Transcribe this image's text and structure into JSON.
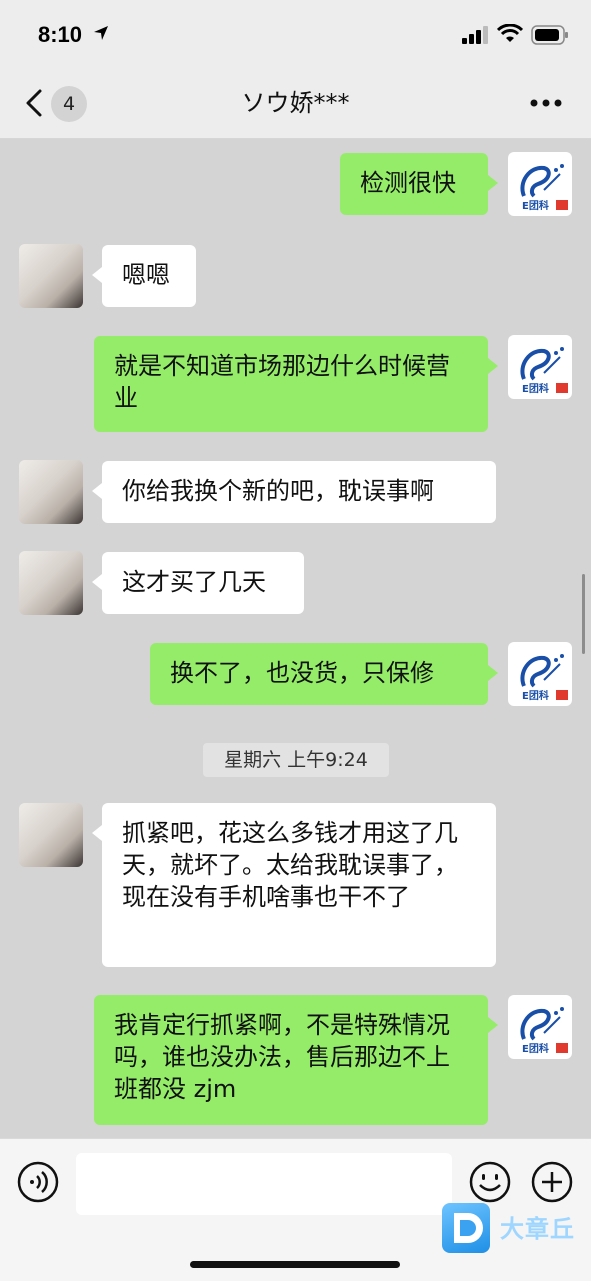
{
  "status_bar": {
    "time": "8:10"
  },
  "nav": {
    "unread_count": "4",
    "title": "ソウ娇***"
  },
  "messages": [
    {
      "side": "right",
      "text": "检测很快"
    },
    {
      "side": "left",
      "text": "嗯嗯"
    },
    {
      "side": "right",
      "text": "就是不知道市场那边什么时候营业"
    },
    {
      "side": "left",
      "text": "你给我换个新的吧，耽误事啊"
    },
    {
      "side": "left",
      "text": "这才买了几天"
    },
    {
      "side": "right",
      "text": "换不了，也没货，只保修"
    },
    {
      "side": "left",
      "text": "抓紧吧，花这么多钱才用这了几天，就坏了。太给我耽误事了，现在没有手机啥事也干不了"
    },
    {
      "side": "right",
      "text": "我肯定行抓紧啊，不是特殊情况吗，谁也没办法，售后那边不上班都没 zjm"
    }
  ],
  "time_divider": "星期六 上午9:24",
  "avatar_right": {
    "logo_text": "E团科",
    "brand_color": "#1a4fa8",
    "flag_color": "#e03a2f"
  },
  "input": {
    "placeholder": ""
  },
  "watermark": {
    "text": "大章丘"
  },
  "colors": {
    "bubble_right": "#95ec69",
    "bubble_left": "#ffffff",
    "chat_bg": "#d4d4d4"
  },
  "icons": [
    "location-arrow-icon",
    "signal-icon",
    "wifi-icon",
    "battery-icon",
    "back-icon",
    "more-icon",
    "voice-icon",
    "emoji-icon",
    "plus-icon"
  ]
}
